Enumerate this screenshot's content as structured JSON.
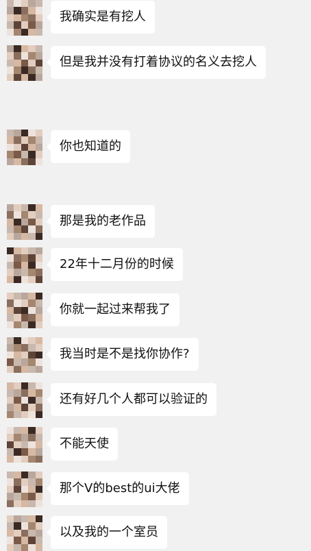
{
  "conversation": {
    "messages": [
      {
        "text": "我确实是有挖人"
      },
      {
        "text": "但是我并没有打着协议的名义去挖人"
      },
      {
        "text": "你也知道的"
      },
      {
        "text": "那是我的老作品"
      },
      {
        "text": "22年十二月份的时候"
      },
      {
        "text": "你就一起过来帮我了"
      },
      {
        "text": "我当时是不是找你协作?"
      },
      {
        "text": "还有好几个人都可以验证的"
      },
      {
        "text": "不能天使"
      },
      {
        "text": "那个V的best的ui大佬"
      },
      {
        "text": "以及我的一个室员"
      }
    ]
  }
}
